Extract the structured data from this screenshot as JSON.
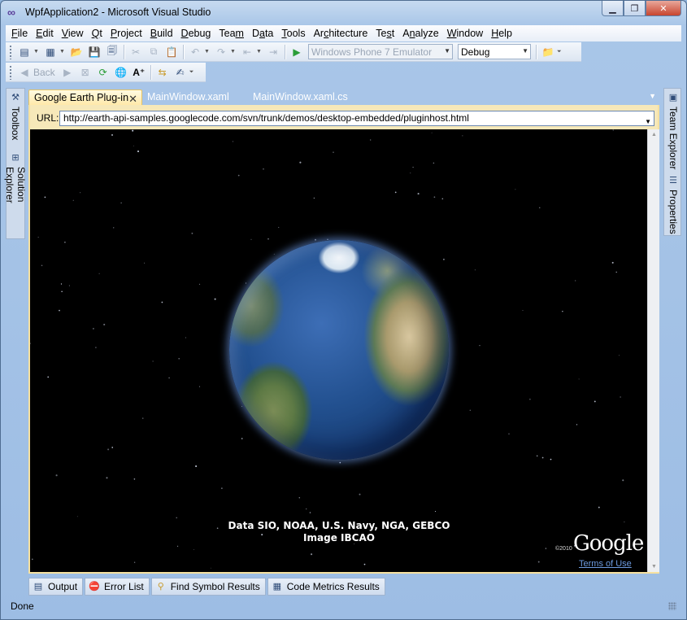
{
  "window": {
    "title": "WpfApplication2 - Microsoft Visual Studio"
  },
  "menu": [
    {
      "label": "File",
      "key": "F"
    },
    {
      "label": "Edit",
      "key": "E"
    },
    {
      "label": "View",
      "key": "V"
    },
    {
      "label": "Qt",
      "key": "Q"
    },
    {
      "label": "Project",
      "key": "P"
    },
    {
      "label": "Build",
      "key": "B"
    },
    {
      "label": "Debug",
      "key": "D"
    },
    {
      "label": "Team",
      "key": "m"
    },
    {
      "label": "Data",
      "key": "a"
    },
    {
      "label": "Tools",
      "key": "T"
    },
    {
      "label": "Architecture",
      "key": "c"
    },
    {
      "label": "Test",
      "key": "s"
    },
    {
      "label": "Analyze",
      "key": "n"
    },
    {
      "label": "Window",
      "key": "W"
    },
    {
      "label": "Help",
      "key": "H"
    }
  ],
  "toolbar": {
    "device_target": "Windows Phone 7 Emulator",
    "configuration": "Debug",
    "back_label": "Back"
  },
  "side_panels": {
    "left": [
      "Toolbox",
      "Solution Explorer"
    ],
    "right": [
      "Team Explorer",
      "Properties"
    ]
  },
  "doc_tabs": [
    {
      "label": "Google Earth Plug-in",
      "active": true
    },
    {
      "label": "MainWindow.xaml",
      "active": false
    },
    {
      "label": "MainWindow.xaml.cs",
      "active": false
    }
  ],
  "url": {
    "label": "URL:",
    "value": "http://earth-api-samples.googlecode.com/svn/trunk/demos/desktop-embedded/pluginhost.html"
  },
  "viewer": {
    "credit_line1": "Data SIO, NOAA, U.S. Navy, NGA, GEBCO",
    "credit_line2": "Image IBCAO",
    "copyright": "©2010",
    "logo": "Google",
    "terms": "Terms of Use"
  },
  "bottom_tabs": [
    {
      "label": "Output",
      "icon": "output-icon"
    },
    {
      "label": "Error List",
      "icon": "error-list-icon"
    },
    {
      "label": "Find Symbol Results",
      "icon": "find-symbol-icon"
    },
    {
      "label": "Code Metrics Results",
      "icon": "code-metrics-icon"
    }
  ],
  "status": {
    "text": "Done"
  }
}
